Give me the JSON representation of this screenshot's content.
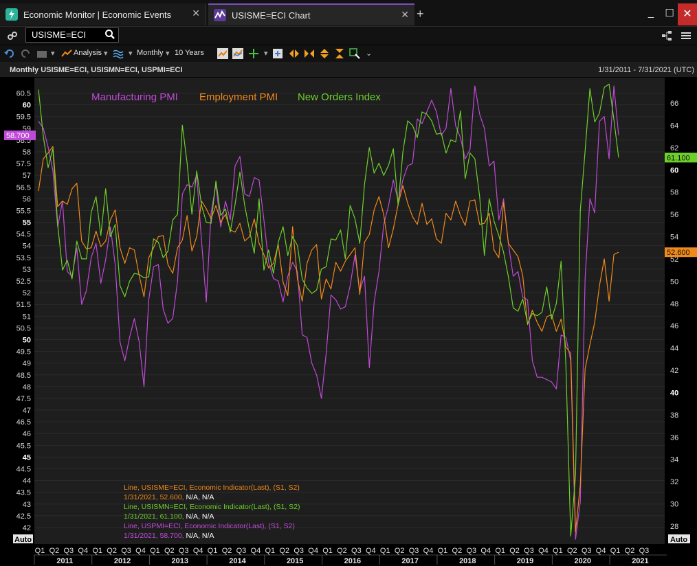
{
  "tabs": [
    {
      "label": "Economic Monitor | Economic Events"
    },
    {
      "label": "USISME=ECI Chart"
    }
  ],
  "search": {
    "value": "USISME=ECI"
  },
  "toolbar": {
    "analysis": "Analysis",
    "interval": "Monthly",
    "range": "10 Years"
  },
  "info": {
    "title": "Monthly USISME=ECI, USISMN=ECI, USPMI=ECI",
    "daterange": "1/31/2011 - 7/31/2021 (UTC)"
  },
  "auto_left": "Auto",
  "auto_right": "Auto",
  "colors": {
    "Manufacturing PMI": "#c04ad8",
    "Employment PMI": "#f08a1a",
    "New Orders Index": "#6cd12a"
  },
  "chart_data": {
    "type": "line",
    "legend": [
      "Manufacturing PMI",
      "Employment PMI",
      "New Orders Index"
    ],
    "x_start": "2011-01",
    "left_axis": {
      "min": 41.5,
      "max": 61,
      "ticks": [
        42,
        42.5,
        43,
        43.5,
        44,
        44.5,
        45,
        45.5,
        46,
        46.5,
        47,
        47.5,
        48,
        48.5,
        49,
        49.5,
        50,
        50.5,
        51,
        51.5,
        52,
        52.5,
        53,
        53.5,
        54,
        54.5,
        55,
        55.5,
        56,
        56.5,
        57,
        57.5,
        58,
        58.5,
        59,
        59.5,
        60,
        60.5
      ],
      "bold": [
        45,
        50,
        55,
        60
      ]
    },
    "right_axis": {
      "min": 27,
      "max": 68,
      "ticks": [
        28,
        30,
        32,
        34,
        36,
        38,
        40,
        42,
        44,
        46,
        48,
        50,
        52,
        54,
        56,
        58,
        60,
        62,
        64,
        66
      ],
      "bold": [
        40,
        60
      ]
    },
    "x_quarters": [
      "Q1",
      "Q2",
      "Q3",
      "Q4",
      "Q1",
      "Q2",
      "Q3",
      "Q4",
      "Q1",
      "Q2",
      "Q3",
      "Q4",
      "Q1",
      "Q2",
      "Q3",
      "Q4",
      "Q1",
      "Q2",
      "Q3",
      "Q4",
      "Q1",
      "Q2",
      "Q3",
      "Q4",
      "Q1",
      "Q2",
      "Q3",
      "Q4",
      "Q1",
      "Q2",
      "Q3",
      "Q4",
      "Q1",
      "Q2",
      "Q3",
      "Q4",
      "Q1",
      "Q2",
      "Q3",
      "Q4",
      "Q1",
      "Q2",
      "Q3"
    ],
    "x_years": [
      "2011",
      "2012",
      "2013",
      "2014",
      "2015",
      "2016",
      "2017",
      "2018",
      "2019",
      "2020",
      "2021"
    ],
    "series": [
      {
        "name": "Manufacturing PMI",
        "axis": "left",
        "last": "58.700",
        "values": [
          59.3,
          59,
          58.2,
          57.2,
          54.8,
          55.9,
          52.9,
          52.7,
          53.9,
          51.5,
          52.1,
          53.5,
          54.1,
          52.4,
          53.4,
          54.8,
          53.2,
          49.9,
          49.1,
          50.1,
          50.9,
          49.9,
          48.0,
          51.7,
          53.1,
          53.2,
          51.3,
          50.7,
          50.9,
          52.5,
          56.2,
          56.6,
          56.5,
          57.0,
          54.2,
          51.6,
          55.4,
          56.6,
          54.8,
          55.9,
          55.1,
          57.4,
          57.8,
          56.2,
          56.1,
          56.9,
          56.8,
          55.1,
          53.3,
          52.6,
          52.5,
          51.6,
          52.7,
          53.3,
          52.9,
          50.2,
          50.1,
          49.0,
          48.5,
          47.5,
          49.4,
          51.9,
          51.7,
          51.3,
          51.4,
          52.3,
          53.6,
          52.1,
          52.7,
          48.8,
          51.6,
          52.9,
          54.9,
          55.7,
          56.8,
          55.9,
          56.8,
          57.4,
          57.5,
          59.4,
          59.2,
          59.7,
          60.2,
          59.7,
          58.7,
          59.0,
          60.7,
          59.1,
          58.6,
          57.7,
          58.1,
          60.8,
          59.6,
          59.0,
          57.4,
          57.6,
          55.1,
          56.0,
          54.1,
          52.7,
          52.9,
          51.8,
          51.7,
          49.1,
          48.4,
          48.4,
          48.3,
          48.2,
          47.9,
          50.2,
          50.1,
          49.1,
          41.5,
          43.1,
          52.6,
          56.0,
          55.4,
          59.3,
          59.5,
          57.7,
          60.8,
          58.7
        ]
      },
      {
        "name": "Employment PMI",
        "axis": "right",
        "last": "52.600",
        "values": [
          58.1,
          61.0,
          61.5,
          62.1,
          56.7,
          57.2,
          56.9,
          58.3,
          58.8,
          53.6,
          52.9,
          53.0,
          54.5,
          53.1,
          53.6,
          55.5,
          56.4,
          53.0,
          51.6,
          53.0,
          52.8,
          50.5,
          48.6,
          52.1,
          53.0,
          54.0,
          54.1,
          51.5,
          50.7,
          53.0,
          53.7,
          55.9,
          52.7,
          54.0,
          57.2,
          56.5,
          55.6,
          56.8,
          55.3,
          56.0,
          54.6,
          54.4,
          55.2,
          53.6,
          54.0,
          55.6,
          53.4,
          52.4,
          51.2,
          51.6,
          53.3,
          49.9,
          48.7,
          54.9,
          50.2,
          48.2,
          51.6,
          52.8,
          53.3,
          48.4,
          50.2,
          49.3,
          51.7,
          50.9,
          51.8,
          52.4,
          53.0,
          48.8,
          53.5,
          54.2,
          56.4,
          57.6,
          56.0,
          53.0,
          54.7,
          56.9,
          58.6,
          57.0,
          55.8,
          55.1,
          57.0,
          55.1,
          55.6,
          53.8,
          53.4,
          56.1,
          55.5,
          57.2,
          55.9,
          55.0,
          57.2,
          57.3,
          55.1,
          55.2,
          56.1,
          52.8,
          52.1,
          57.1,
          53.4,
          52.8,
          52.2,
          50.5,
          46.1,
          47.4,
          46.3,
          45.5,
          46.8,
          47.0,
          45.5,
          46.6,
          44.1,
          43.5,
          27.5,
          31.7,
          42.1,
          44.3,
          46.3,
          49.6,
          52.0,
          48.2,
          52.4,
          52.6
        ]
      },
      {
        "name": "New Orders Index",
        "axis": "right",
        "last": "61.100",
        "values": [
          67.2,
          63.0,
          60.2,
          61.9,
          55.1,
          51.0,
          51.9,
          50.2,
          53.6,
          52.0,
          52.0,
          56.2,
          57.6,
          54.1,
          58.3,
          54.0,
          55.1,
          49.6,
          48.6,
          50.0,
          50.7,
          50.6,
          50.3,
          50.4,
          53.8,
          53.5,
          52.1,
          52.7,
          55.5,
          56.0,
          64.0,
          60.6,
          56.0,
          59.9,
          56.8,
          55.3,
          55.2,
          59.0,
          55.9,
          56.5,
          54.4,
          56.9,
          59.8,
          56.8,
          54.6,
          52.5,
          57.4,
          51.0,
          52.8,
          50.7,
          53.5,
          54.9,
          52.3,
          54.0,
          53.2,
          50.2,
          49.4,
          48.9,
          49.2,
          51.1,
          51.3,
          53.8,
          53.7,
          54.6,
          52.0,
          56.8,
          55.6,
          53.4,
          58.7,
          62.0,
          59.7,
          60.6,
          59.5,
          60.4,
          61.9,
          56.8,
          61.6,
          64.4,
          64.0,
          62.9,
          65.2,
          65.0,
          64.4,
          63.2,
          63.3,
          61.5,
          62.7,
          62.5,
          65.3,
          59.2,
          61.5,
          61.0,
          57.6,
          52.3,
          57.4,
          55.4,
          54.1,
          52.6,
          50.4,
          47.6,
          47.3,
          48.4,
          46.2,
          47.1,
          46.9,
          47.2,
          49.5,
          46.6,
          48.0,
          51.8,
          42.4,
          27.1,
          32.6,
          56.3,
          61.7,
          67.3,
          64.3,
          65.1,
          67.4,
          67.7,
          64.5,
          61.1
        ]
      }
    ],
    "legend_box": [
      {
        "line": "Line, USISME=ECI, Economic Indicator(Last), (S1, S2)",
        "date": "1/31/2021,",
        "value": "52.600,",
        "rest": "N/A, N/A"
      },
      {
        "line": "Line, USISMN=ECI, Economic Indicator(Last), (S1, S2)",
        "date": "1/31/2021,",
        "value": "61.100,",
        "rest": "N/A, N/A"
      },
      {
        "line": "Line, USPMI=ECI, Economic Indicator(Last), (S1, S2)",
        "date": "1/31/2021,",
        "value": "58.700,",
        "rest": "N/A, N/A"
      }
    ]
  }
}
